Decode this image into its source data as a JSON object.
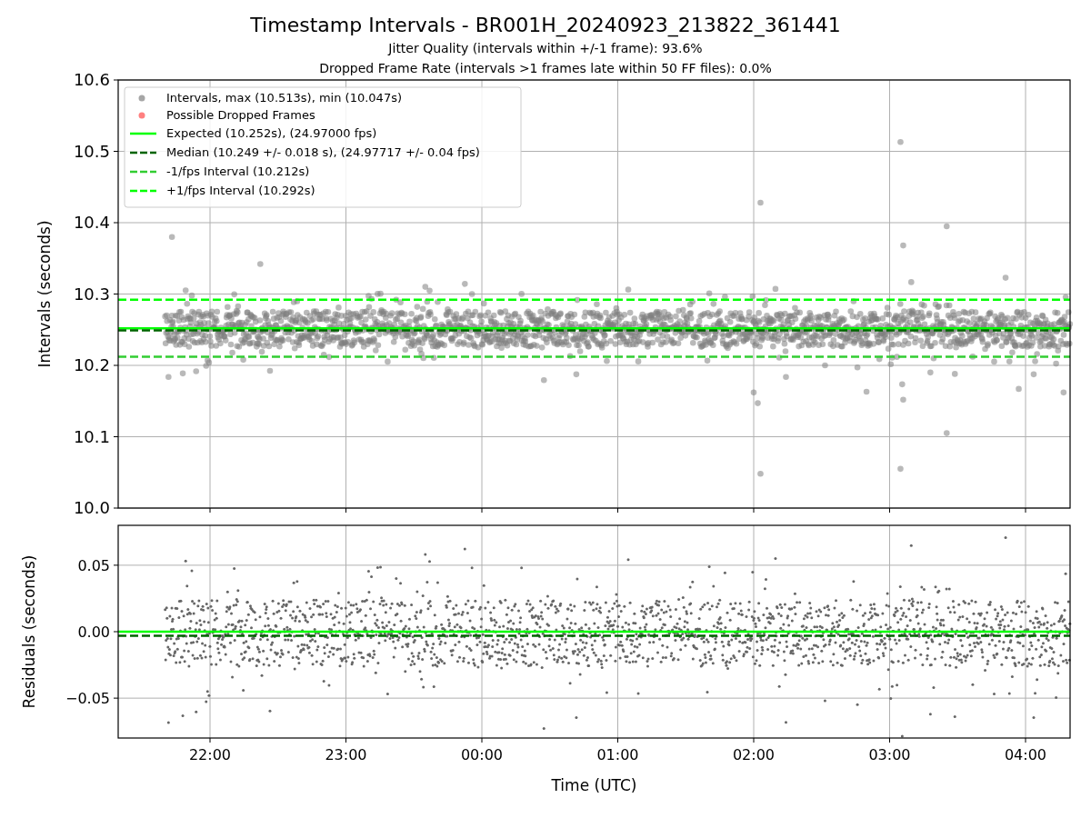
{
  "figure": {
    "title": "Timestamp Intervals - BR001H_20240923_213822_361441",
    "subtitles": [
      "Jitter Quality (intervals within +/-1 frame): 93.6%",
      "Dropped Frame Rate (intervals >1 frames late within 50 FF files): 0.0%"
    ]
  },
  "charts": [
    {
      "legend": [
        {
          "label": "Intervals, max (10.513s), min (10.047s)",
          "kind": "marker",
          "color": "#a6a6a6"
        },
        {
          "label": "Possible Dropped Frames",
          "kind": "marker",
          "color": "#ff8080"
        },
        {
          "label": "Expected (10.252s), (24.97000 fps)",
          "kind": "solid",
          "color": "#00ff00"
        },
        {
          "label": "Median (10.249 +/- 0.018 s), (24.97717 +/- 0.04 fps)",
          "kind": "dashed",
          "color": "#006400"
        },
        {
          "label": "-1/fps Interval (10.212s)",
          "kind": "dashed",
          "color": "#32cd32"
        },
        {
          "label": "+1/fps Interval (10.292s)",
          "kind": "dashed",
          "color": "#00ff00"
        }
      ],
      "chart_data": {
        "type": "scatter",
        "ylabel": "Intervals (seconds)",
        "grid": true,
        "categories": [
          null,
          null,
          null,
          null,
          null,
          null,
          null
        ],
        "ylim": [
          10.0,
          10.6
        ],
        "yticks": [
          {
            "value": 10.0,
            "label": "10.0"
          },
          {
            "value": 10.1,
            "label": "10.1"
          },
          {
            "value": 10.2,
            "label": "10.2"
          },
          {
            "value": 10.3,
            "label": "10.3"
          },
          {
            "value": 10.4,
            "label": "10.4"
          },
          {
            "value": 10.5,
            "label": "10.5"
          },
          {
            "value": 10.6,
            "label": "10.6"
          }
        ],
        "ref_lines": [
          {
            "axis": "y",
            "value": 10.252,
            "color": "#00ff00",
            "line_style": "solid"
          },
          {
            "axis": "y",
            "value": 10.249,
            "color": "#006400",
            "line_style": "dashed"
          },
          {
            "axis": "y",
            "value": 10.212,
            "color": "#32cd32",
            "line_style": "dashed"
          },
          {
            "axis": "y",
            "value": 10.292,
            "color": "#00ff00",
            "line_style": "dashed"
          }
        ]
      }
    },
    {
      "chart_data": {
        "type": "scatter",
        "xlabel": "Time (UTC)",
        "ylabel": "Residuals (seconds)",
        "grid": true,
        "categories": [
          "22:00",
          "23:00",
          "00:00",
          "01:00",
          "02:00",
          "03:00",
          "04:00"
        ],
        "ylim": [
          -0.08,
          0.08
        ],
        "yticks": [
          {
            "value": 0.05,
            "label": "0.05"
          },
          {
            "value": 0,
            "label": "0.00"
          },
          {
            "value": -0.05,
            "label": "−0.05"
          }
        ],
        "ref_lines": [
          {
            "axis": "y",
            "value": 0,
            "color": "#00ff00",
            "line_style": "solid"
          },
          {
            "axis": "y",
            "value": -0.003,
            "color": "#006400",
            "line_style": "dashed"
          }
        ]
      }
    }
  ]
}
